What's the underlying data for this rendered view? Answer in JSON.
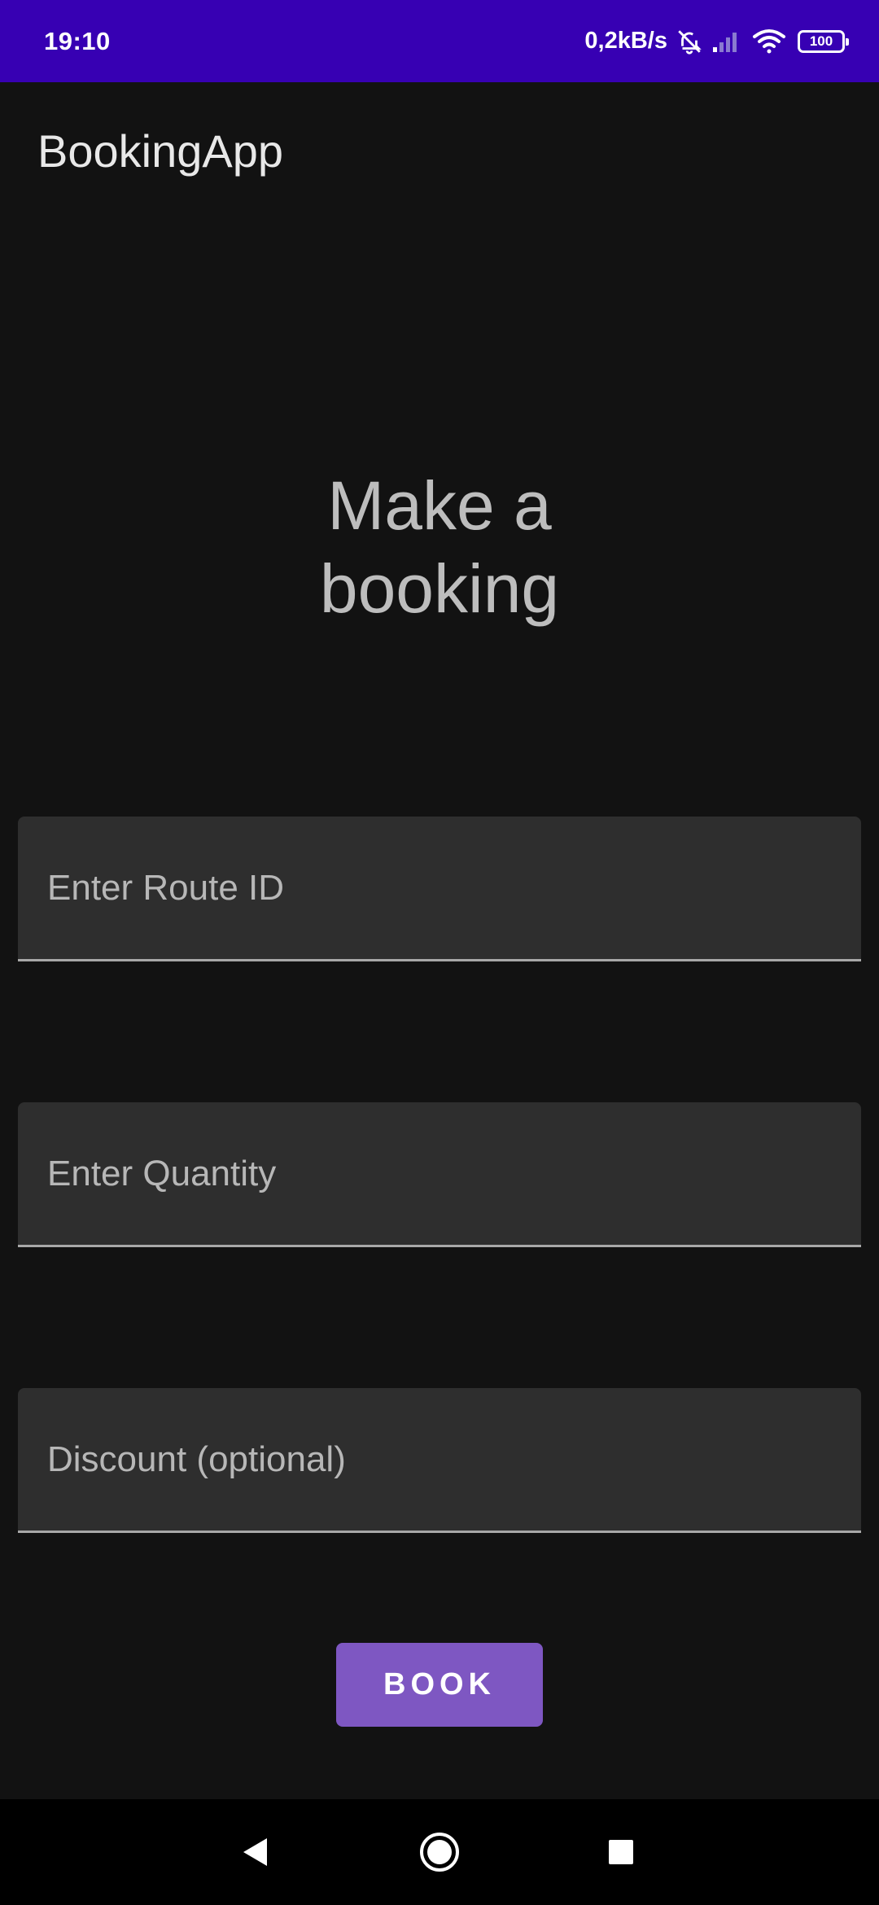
{
  "status_bar": {
    "time": "19:10",
    "network_speed": "0,2kB/s",
    "battery_level": "100",
    "icons": [
      "mute-bell-icon",
      "signal-icon",
      "wifi-icon",
      "battery-icon"
    ]
  },
  "app_bar": {
    "title": "BookingApp"
  },
  "heading": {
    "line1": "Make a",
    "line2": "booking"
  },
  "form": {
    "route_id": {
      "placeholder": "Enter Route ID",
      "value": ""
    },
    "quantity": {
      "placeholder": "Enter Quantity",
      "value": ""
    },
    "discount": {
      "placeholder": "Discount (optional)",
      "value": ""
    }
  },
  "book_button": {
    "label": "BOOK"
  },
  "nav_bar": {
    "icons": [
      "back-icon",
      "home-icon",
      "recents-icon"
    ]
  },
  "colors": {
    "status_bar": "#3700B3",
    "background": "#121212",
    "field_background": "#2E2E2E",
    "button": "#7E57C2",
    "nav_bar": "#000000"
  }
}
